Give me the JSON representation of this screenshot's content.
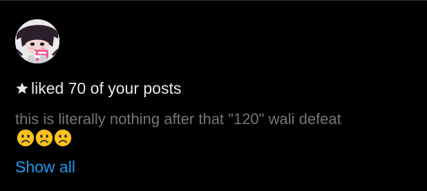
{
  "notification": {
    "action_text": "liked 70 of your posts",
    "post_preview": "this is literally nothing after that \"120\" wali defeat",
    "emojis": [
      "frowning-face",
      "frowning-face",
      "frowning-face"
    ],
    "show_all_label": "Show all"
  },
  "colors": {
    "background": "#000000",
    "primary_text": "#e7e9ea",
    "secondary_text": "#71767b",
    "link": "#1d9bf0",
    "divider": "#2f3336",
    "emoji_face": "#fcc21b"
  },
  "icons": {
    "action": "star-icon",
    "avatar": "anime-avatar"
  }
}
